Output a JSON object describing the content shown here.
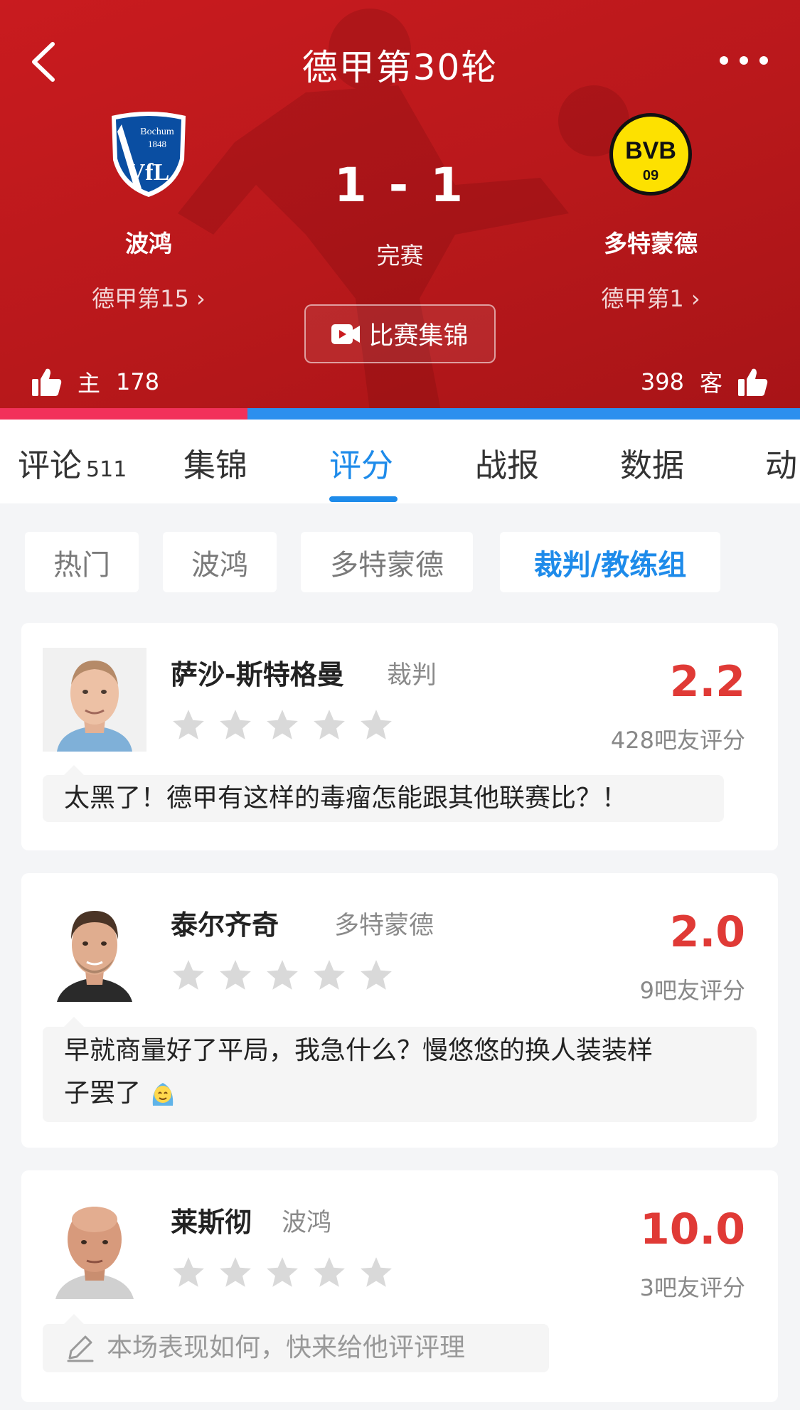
{
  "header": {
    "title": "德甲第30轮",
    "score": "1 - 1",
    "status": "完赛",
    "highlights_label": "比赛集锦",
    "home": {
      "name": "波鸿",
      "rank": "德甲第15",
      "vote_label": "主",
      "votes": "178",
      "logo_text_top": "Bochum",
      "logo_text_year": "1848",
      "logo_letters": "VfL"
    },
    "away": {
      "name": "多特蒙德",
      "rank": "德甲第1",
      "vote_label": "客",
      "votes": "398",
      "logo_letters": "BVB",
      "logo_number": "09"
    },
    "vote_share_home": 0.309
  },
  "tabs": [
    {
      "label": "评论",
      "count": "511"
    },
    {
      "label": "集锦"
    },
    {
      "label": "评分",
      "active": true
    },
    {
      "label": "战报"
    },
    {
      "label": "数据"
    },
    {
      "label": "动"
    }
  ],
  "filters": [
    {
      "label": "热门"
    },
    {
      "label": "波鸿"
    },
    {
      "label": "多特蒙德"
    },
    {
      "label": "裁判/教练组",
      "active": true
    }
  ],
  "ratings": [
    {
      "name": "萨沙-斯特格曼",
      "role": "裁判",
      "score": "2.2",
      "count_label": "428吧友评分",
      "stars_filled": 0,
      "comment": "太黑了！德甲有这样的毒瘤怎能跟其他联赛比？！"
    },
    {
      "name": "泰尔齐奇",
      "role": "多特蒙德",
      "score": "2.0",
      "count_label": "9吧友评分",
      "stars_filled": 0,
      "comment_line1": "早就商量好了平局，我急什么？慢悠悠的换人装装样",
      "comment_line2": "子罢了"
    },
    {
      "name": "莱斯彻",
      "role": "波鸿",
      "score": "10.0",
      "count_label": "3吧友评分",
      "stars_filled": 0,
      "placeholder": "本场表现如何，快来给他评评理"
    }
  ],
  "colors": {
    "header_red": "#c91b1f",
    "accent_blue": "#1e8bea",
    "rating_red": "#e03a36",
    "home_bar": "#f2315a",
    "away_bar": "#2c8fee"
  },
  "icons": [
    "back-icon",
    "more-icon",
    "video-icon",
    "thumb-up-icon",
    "star-icon",
    "pencil-icon",
    "emoji-icon"
  ]
}
